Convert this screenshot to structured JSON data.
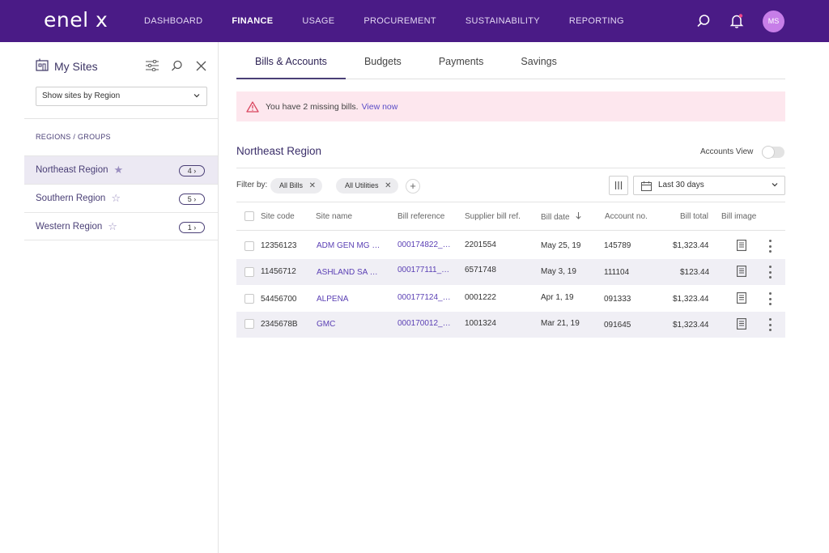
{
  "brand": {
    "logo_text": "enel x",
    "nav_bg": "#4a1b86",
    "accent": "#4a3f76",
    "link": "#5a3fb4"
  },
  "nav": {
    "items": [
      {
        "label": "DASHBOARD"
      },
      {
        "label": "FINANCE",
        "active": true
      },
      {
        "label": "USAGE"
      },
      {
        "label": "PROCUREMENT"
      },
      {
        "label": "SUSTAINABILITY"
      },
      {
        "label": "REPORTING"
      }
    ],
    "avatar_initials": "MS",
    "icons": [
      "search-icon",
      "notification-bell-icon"
    ]
  },
  "sidebar": {
    "title": "My Sites",
    "region_select": "Show sites by Region",
    "section_label": "REGIONS / GROUPS",
    "regions": [
      {
        "name": "Northeast Region",
        "count": "4",
        "starred": true,
        "active": true
      },
      {
        "name": "Southern Region",
        "count": "5",
        "starred": false,
        "active": false
      },
      {
        "name": "Western Region",
        "count": "1",
        "starred": false,
        "active": false
      }
    ]
  },
  "tabs": [
    {
      "label": "Bills & Accounts",
      "active": true
    },
    {
      "label": "Budgets"
    },
    {
      "label": "Payments"
    },
    {
      "label": "Savings"
    }
  ],
  "alert": {
    "text": "You have 2 missing bills.",
    "link": "View now"
  },
  "section": {
    "title": "Northeast Region",
    "accounts_view_label": "Accounts View"
  },
  "filters": {
    "label": "Filter by:",
    "chips": [
      "All Bills",
      "All Utilities"
    ],
    "date_range": "Last 30 days"
  },
  "table": {
    "headers": {
      "site_code": "Site code",
      "site_name": "Site name",
      "bill_reference": "Bill reference",
      "supplier_ref": "Supplier bill ref.",
      "bill_date": "Bill date",
      "account_no": "Account no.",
      "bill_total": "Bill total",
      "bill_image": "Bill image"
    },
    "rows": [
      {
        "site_code": "12356123",
        "site_name": "ADM GEN MG …",
        "bill_reference": "000174822_…",
        "supplier_ref": "2201554",
        "bill_date": "May 25, 19",
        "account_no": "145789",
        "bill_total": "$1,323.44"
      },
      {
        "site_code": "11456712",
        "site_name": "ASHLAND SA …",
        "bill_reference": "000177111_…",
        "supplier_ref": "6571748",
        "bill_date": "May 3, 19",
        "account_no": "111104",
        "bill_total": "$123.44"
      },
      {
        "site_code": "54456700",
        "site_name": "ALPENA",
        "bill_reference": "000177124_…",
        "supplier_ref": "0001222",
        "bill_date": "Apr 1, 19",
        "account_no": "091333",
        "bill_total": "$1,323.44"
      },
      {
        "site_code": "2345678B",
        "site_name": "GMC",
        "bill_reference": "000170012_…",
        "supplier_ref": "1001324",
        "bill_date": "Mar 21, 19",
        "account_no": "091645",
        "bill_total": "$1,323.44"
      }
    ]
  }
}
